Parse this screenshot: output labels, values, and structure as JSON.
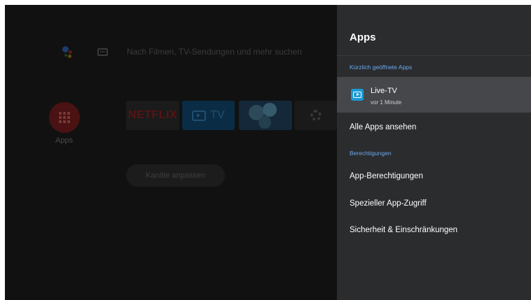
{
  "launcher": {
    "search_hint": "Nach Filmen, TV-Sendungen und mehr suchen",
    "apps_label": "Apps",
    "tiles": {
      "netflix": "NETFLIX",
      "tv": "TV"
    },
    "channels_button": "Kanäle anpassen"
  },
  "panel": {
    "title": "Apps",
    "recent_header": "Kürzlich geöffnete Apps",
    "recent_apps": [
      {
        "name": "Live-TV",
        "time": "vor 1 Minute",
        "icon": "live-tv-icon",
        "selected": true
      }
    ],
    "see_all": "Alle Apps ansehen",
    "permissions_header": "Berechtigungen",
    "items": [
      "App-Berechtigungen",
      "Spezieller App-Zugriff",
      "Sicherheit & Einschränkungen"
    ]
  },
  "colors": {
    "panel_bg": "#2b2c2e",
    "selected_bg": "#45474a",
    "section_header": "#6aa8ef",
    "live_tv_icon": "#1c9ad6",
    "netflix_red": "#5a1313"
  }
}
